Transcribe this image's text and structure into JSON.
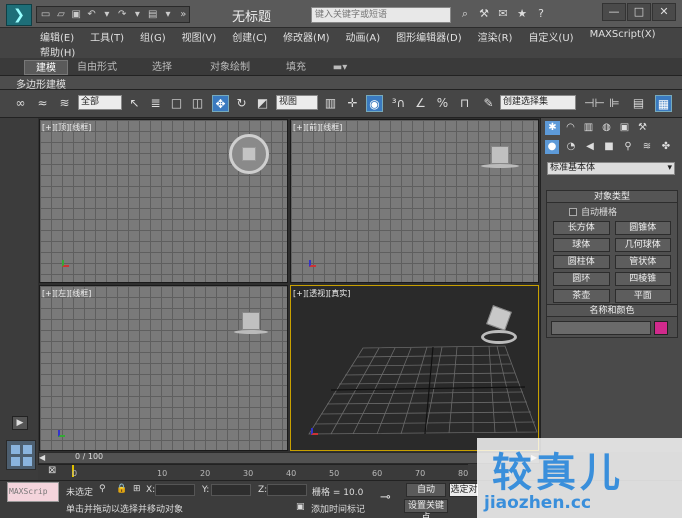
{
  "window": {
    "title": "无标题",
    "search_placeholder": "键入关键字或短语"
  },
  "menu": {
    "row1": [
      "编辑(E)",
      "工具(T)",
      "组(G)",
      "视图(V)",
      "创建(C)",
      "修改器(M)",
      "动画(A)",
      "图形编辑器(D)",
      "渲染(R)",
      "自定义(U)",
      "MAXScript(X)"
    ],
    "row2": [
      "帮助(H)"
    ]
  },
  "ribbon": {
    "tabs": [
      "建模",
      "自由形式",
      "选择",
      "对象绘制",
      "填充"
    ],
    "active_tab": "建模",
    "sub_label": "多边形建模"
  },
  "toolbar": {
    "selection_filter": "全部",
    "ref_coord": "视图",
    "named_selection": "创建选择集"
  },
  "viewports": {
    "top_label": "[+][顶][线框]",
    "front_label": "[+][前][线框]",
    "left_label": "[+][左][线框]",
    "persp_label": "[+][透视][真实]"
  },
  "command_panel": {
    "category": "标准基本体",
    "object_type_title": "对象类型",
    "autogrid": "自动栅格",
    "objects": [
      "长方体",
      "圆锥体",
      "球体",
      "几何球体",
      "圆柱体",
      "管状体",
      "圆环",
      "四棱锥",
      "茶壶",
      "平面"
    ],
    "name_color_title": "名称和颜色",
    "object_color": "#d12a8c"
  },
  "timeline": {
    "frame_counter": "0 / 100",
    "ruler": [
      "0",
      "10",
      "20",
      "30",
      "40",
      "50",
      "60",
      "70",
      "80",
      "90"
    ]
  },
  "statusbar": {
    "maxscript": "MAXScrip",
    "selection_status": "未选定",
    "x_label": "X:",
    "y_label": "Y:",
    "z_label": "Z:",
    "grid": "栅格 = 10.0",
    "auto": "自动",
    "selected": "选定对",
    "set_key": "设置关键点",
    "add_time_tag": "添加时间标记",
    "prompt": "单击并拖动以选择并移动对象"
  },
  "watermark": {
    "cn": "较真儿",
    "url": "jiaozhen.cc"
  },
  "colors": {
    "accent": "#3a7ac0",
    "watermark": "#3a8fdb"
  }
}
